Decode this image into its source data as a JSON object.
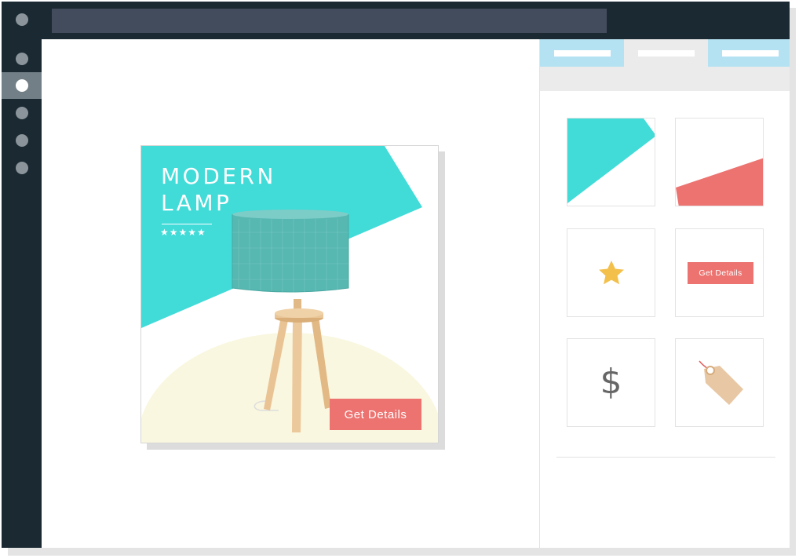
{
  "colors": {
    "chrome": "#1b2932",
    "accent_teal": "#41dbd8",
    "accent_coral": "#ec7370",
    "cream": "#f9f7df",
    "tab_blue": "#b5e2f2",
    "star_gold": "#f3c04c",
    "tag_tan": "#e8c8a4"
  },
  "browser": {
    "icons": [
      "window-dot-icon"
    ]
  },
  "sidebar": {
    "items": [
      {
        "name": "sidebar-item-1",
        "active": false
      },
      {
        "name": "sidebar-item-2",
        "active": true
      },
      {
        "name": "sidebar-item-3",
        "active": false
      },
      {
        "name": "sidebar-item-4",
        "active": false
      },
      {
        "name": "sidebar-item-5",
        "active": false
      }
    ]
  },
  "ad": {
    "title_line1": "MODERN",
    "title_line2": "LAMP",
    "stars": "★★★★★",
    "rating": 4.5,
    "cta_label": "Get Details",
    "image": "lamp-image"
  },
  "panel": {
    "tabs": [
      {
        "name": "tab-1",
        "selected": false
      },
      {
        "name": "tab-2",
        "selected": true
      },
      {
        "name": "tab-3",
        "selected": false
      }
    ],
    "tiles": [
      {
        "name": "teal-shape-tile",
        "icon": "teal-triangle-icon"
      },
      {
        "name": "coral-shape-tile",
        "icon": "coral-wedge-icon"
      },
      {
        "name": "star-tile",
        "icon": "star-icon"
      },
      {
        "name": "button-tile",
        "label": "Get Details"
      },
      {
        "name": "dollar-tile",
        "glyph": "$"
      },
      {
        "name": "tag-tile",
        "icon": "price-tag-icon"
      }
    ]
  }
}
